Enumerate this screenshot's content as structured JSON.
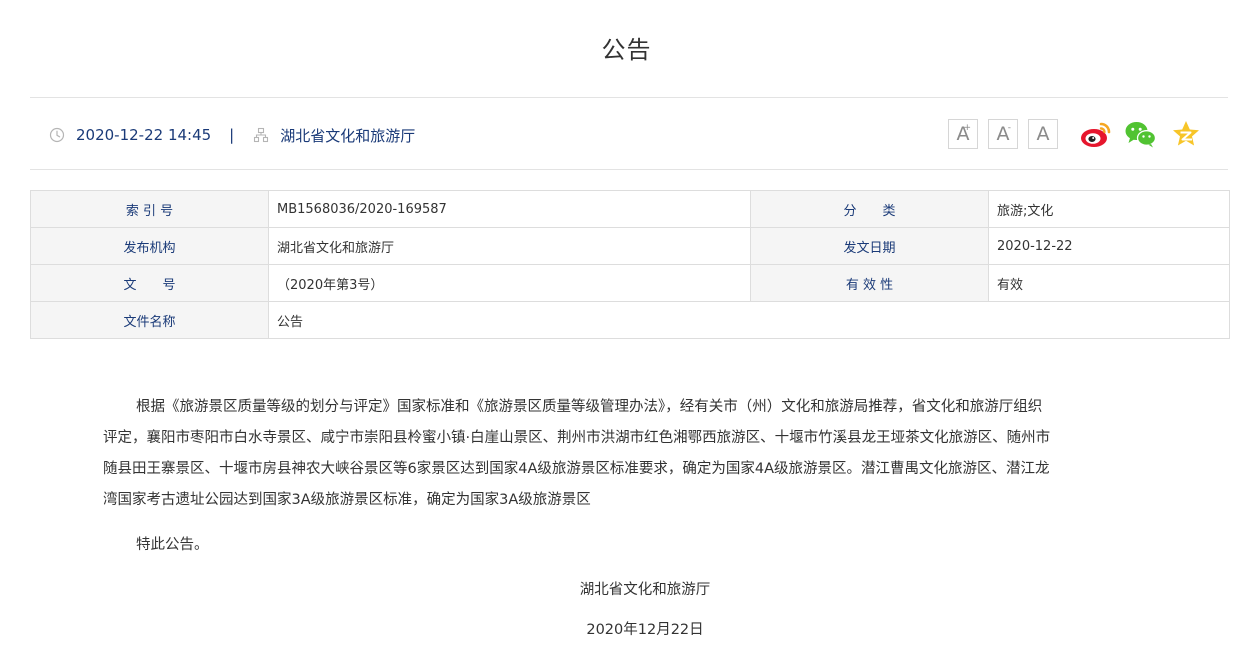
{
  "page": {
    "title": "公告"
  },
  "meta": {
    "datetime": "2020-12-22 14:45",
    "separator": "|",
    "publisher": "湖北省文化和旅游厅"
  },
  "tools": {
    "font_large": "A",
    "font_large_mark": "+",
    "font_small": "A",
    "font_small_mark": "-",
    "font_normal": "A",
    "share_icons": [
      "weibo-icon",
      "wechat-icon",
      "qzone-icon"
    ],
    "colors": {
      "weibo": "#e6162d",
      "weibo_accent": "#f5a623",
      "wechat": "#51c332",
      "qzone": "#f7c528"
    }
  },
  "info_table": {
    "rows": [
      {
        "k1": "索 引 号",
        "v1": "MB1568036/2020-169587",
        "k2": "分　　类",
        "v2": "旅游;文化"
      },
      {
        "k1": "发布机构",
        "v1": "湖北省文化和旅游厅",
        "k2": "发文日期",
        "v2": "2020-12-22"
      },
      {
        "k1": "文　　号",
        "v1": "（2020年第3号）",
        "k2": "有 效 性",
        "v2": "有效"
      },
      {
        "k1": "文件名称",
        "v1": "公告"
      }
    ]
  },
  "article": {
    "lines": [
      "根据《旅游景区质量等级的划分与评定》国家标准和《旅游景区质量等级管理办法》，经有关市（州）文化和旅游局推荐，省文化和旅游厅组织",
      "评定，襄阳市枣阳市白水寺景区、咸宁市崇阳县柃蜜小镇·白崖山景区、荆州市洪湖市红色湘鄂西旅游区、十堰市竹溪县龙王垭茶文化旅游区、随州市",
      "随县田王寨景区、十堰市房县神农大峡谷景区等6家景区达到国家4A级旅游景区标准要求，确定为国家4A级旅游景区。潜江曹禺文化旅游区、潜江龙",
      "湾国家考古遗址公园达到国家3A级旅游景区标准，确定为国家3A级旅游景区"
    ],
    "closing": "特此公告。",
    "signature": "湖北省文化和旅游厅",
    "date": "2020年12月22日"
  }
}
